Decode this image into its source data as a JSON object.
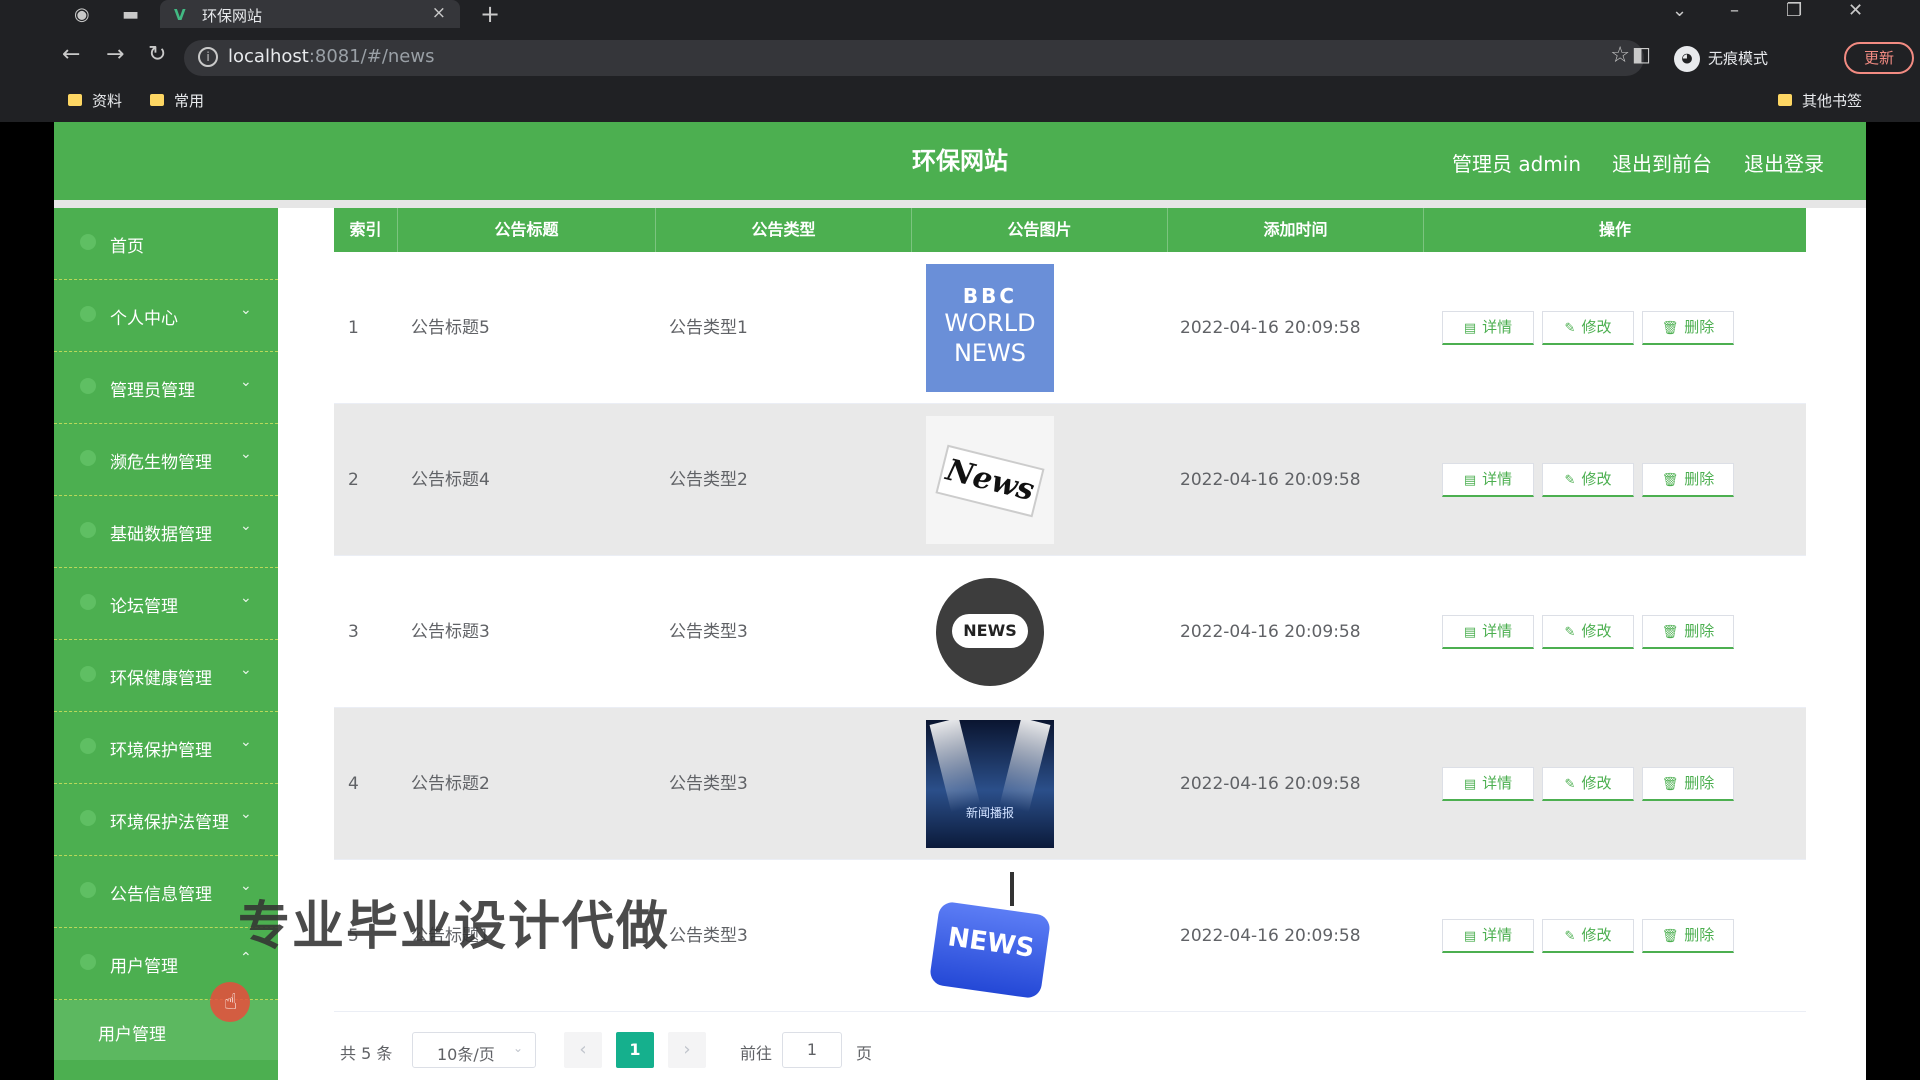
{
  "browser": {
    "tab_title": "环保网站",
    "tab_favicon": "V",
    "url_host": "localhost",
    "url_rest": ":8081/#/news",
    "incognito_label": "无痕模式",
    "update_label": "更新",
    "bookmarks": [
      "资料",
      "常用"
    ],
    "other_bookmarks": "其他书签"
  },
  "header": {
    "title": "环保网站",
    "admin_label": "管理员 admin",
    "frontend_label": "退出到前台",
    "logout_label": "退出登录"
  },
  "sidebar": {
    "items": [
      {
        "label": "首页",
        "arrow": ""
      },
      {
        "label": "个人中心",
        "arrow": "⌄"
      },
      {
        "label": "管理员管理",
        "arrow": "⌄"
      },
      {
        "label": "濒危生物管理",
        "arrow": "⌄"
      },
      {
        "label": "基础数据管理",
        "arrow": "⌄"
      },
      {
        "label": "论坛管理",
        "arrow": "⌄"
      },
      {
        "label": "环保健康管理",
        "arrow": "⌄"
      },
      {
        "label": "环境保护管理",
        "arrow": "⌄"
      },
      {
        "label": "环境保护法管理",
        "arrow": "⌄"
      },
      {
        "label": "公告信息管理",
        "arrow": "⌄"
      },
      {
        "label": "用户管理",
        "arrow": "⌃"
      }
    ],
    "submenu_label": "用户管理"
  },
  "table": {
    "headers": [
      "索引",
      "公告标题",
      "公告类型",
      "公告图片",
      "添加时间",
      "操作"
    ],
    "rows": [
      {
        "index": "1",
        "title": "公告标题5",
        "type": "公告类型1",
        "image": "bbc-world-news",
        "image_text": [
          "BBC",
          "WORLD",
          "NEWS"
        ],
        "time": "2022-04-16 20:09:58"
      },
      {
        "index": "2",
        "title": "公告标题4",
        "type": "公告类型2",
        "image": "newspaper",
        "image_text": [
          "News"
        ],
        "time": "2022-04-16 20:09:58"
      },
      {
        "index": "3",
        "title": "公告标题3",
        "type": "公告类型3",
        "image": "globe-news",
        "image_text": [
          "NEWS"
        ],
        "time": "2022-04-16 20:09:58"
      },
      {
        "index": "4",
        "title": "公告标题2",
        "type": "公告类型3",
        "image": "stage-lights",
        "image_text": [
          "新闻播报"
        ],
        "time": "2022-04-16 20:09:58"
      },
      {
        "index": "5",
        "title": "公告标题1",
        "type": "公告类型3",
        "image": "news-key",
        "image_text": [
          "NEWS"
        ],
        "time": "2022-04-16 20:09:58"
      }
    ],
    "actions": {
      "detail": "详情",
      "edit": "修改",
      "delete": "删除"
    }
  },
  "pagination": {
    "total": "共 5 条",
    "page_size": "10条/页",
    "prev": "‹",
    "current": "1",
    "next": "›",
    "goto_label": "前往",
    "goto_value": "1",
    "page_suffix": "页"
  },
  "watermark": "专业毕业设计代做",
  "colors": {
    "primary": "#4caf50",
    "current_page": "#15b08d"
  }
}
